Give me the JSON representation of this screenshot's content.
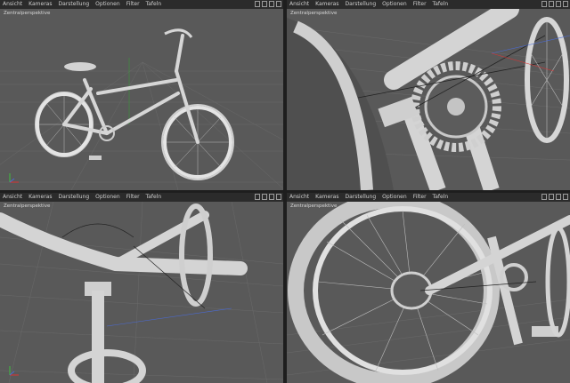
{
  "menu": [
    "Ansicht",
    "Kameras",
    "Darstellung",
    "Optionen",
    "Filter",
    "Tafeln"
  ],
  "viewports": [
    {
      "label": "Zentralperspektive"
    },
    {
      "label": "Zentralperspektive"
    },
    {
      "label": "Zentralperspektive"
    },
    {
      "label": "Zentralperspektive"
    }
  ],
  "colors": {
    "background": "#595959",
    "menubar": "#2b2b2b",
    "model": "#c8c8c8",
    "grid": "#6a6a6a"
  },
  "icons": [
    "move-icon",
    "rotate-icon",
    "zoom-icon",
    "maximize-icon"
  ]
}
